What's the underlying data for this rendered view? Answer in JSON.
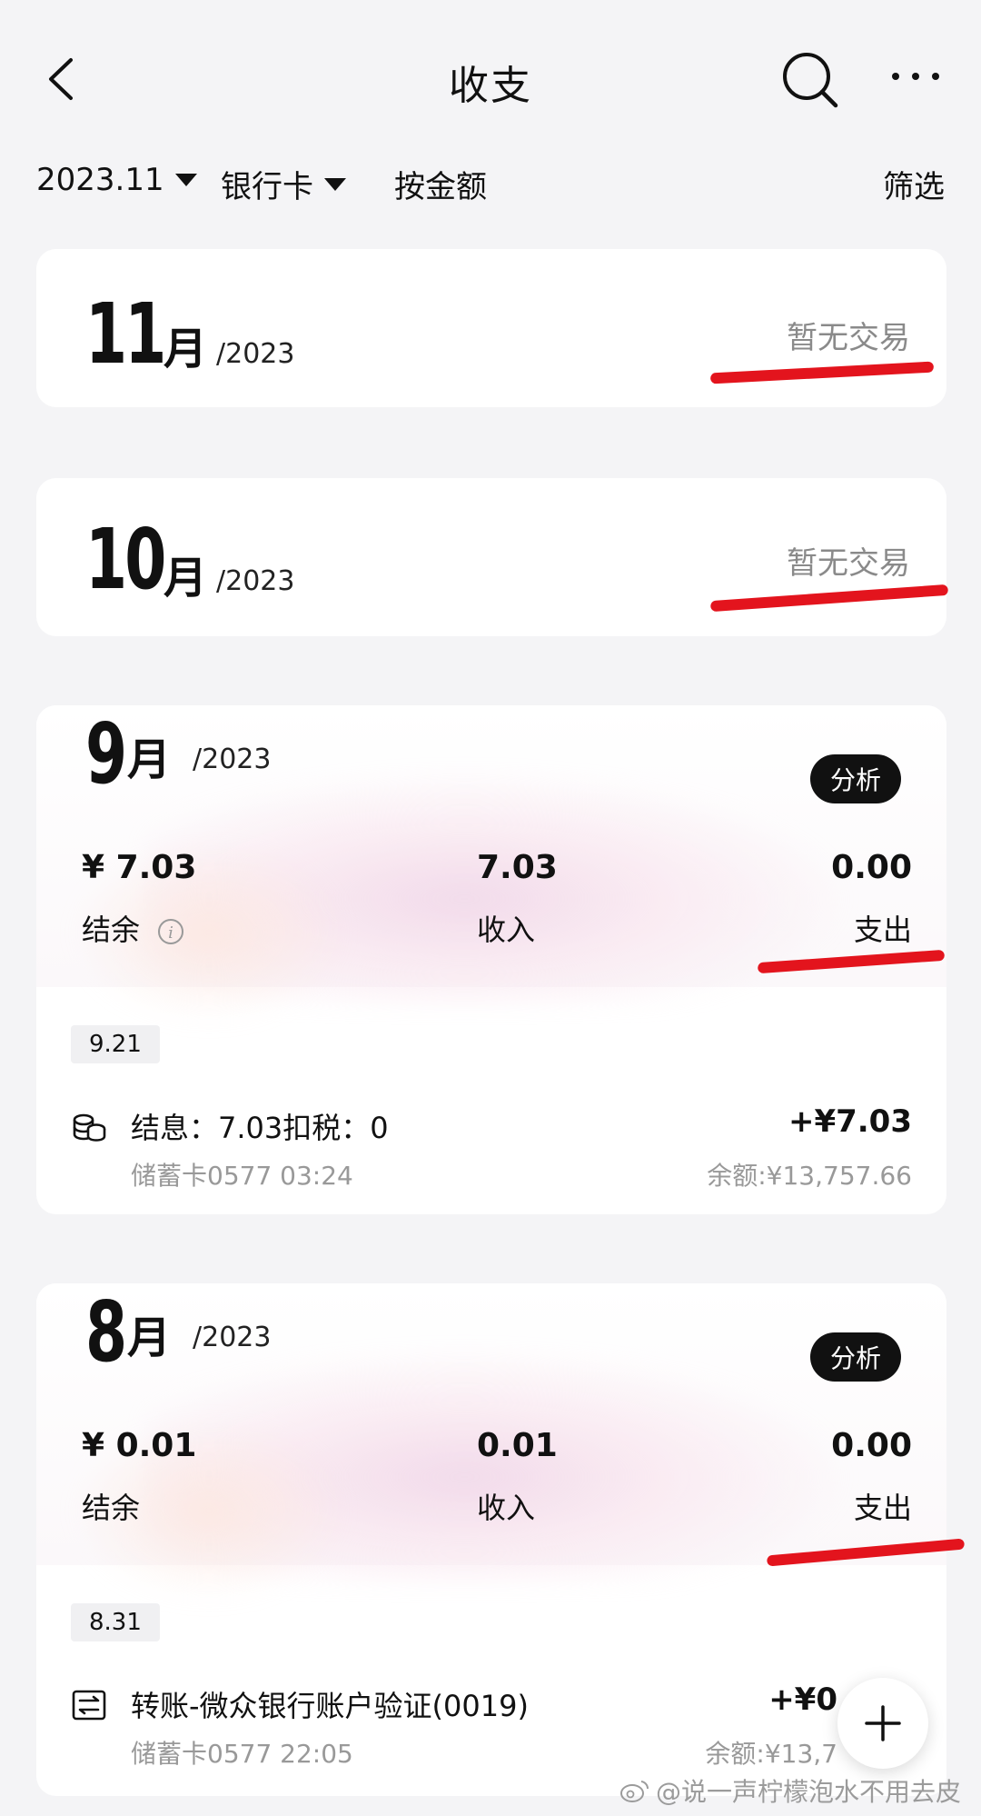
{
  "header": {
    "title": "收支"
  },
  "filters": {
    "month": "2023.11",
    "account": "银行卡",
    "sort": "按金额",
    "filter": "筛选"
  },
  "months": [
    {
      "month": "11",
      "suffix": "月",
      "year": "/2023",
      "status": "暂无交易"
    },
    {
      "month": "10",
      "suffix": "月",
      "year": "/2023",
      "status": "暂无交易"
    },
    {
      "month": "9",
      "suffix": "月",
      "year": "/2023",
      "analyze": "分析",
      "balance": "¥ 7.03",
      "balance_label": "结余",
      "income": "7.03",
      "income_label": "收入",
      "expense": "0.00",
      "expense_label": "支出",
      "date": "9.21",
      "tx": {
        "title": "结息：7.03扣税：0",
        "sub": "储蓄卡0577 03:24",
        "amount": "+¥7.03",
        "balance": "余额:¥13,757.66",
        "icon": "coins-icon"
      }
    },
    {
      "month": "8",
      "suffix": "月",
      "year": "/2023",
      "analyze": "分析",
      "balance": "¥ 0.01",
      "balance_label": "结余",
      "income": "0.01",
      "income_label": "收入",
      "expense": "0.00",
      "expense_label": "支出",
      "date": "8.31",
      "tx": {
        "title": "转账-微众银行账户验证(0019)",
        "sub": "储蓄卡0577 22:05",
        "amount": "+¥0",
        "balance": "余额:¥13,7",
        "icon": "transfer-icon"
      }
    }
  ],
  "watermark": "@说一声柠檬泡水不用去皮",
  "colors": {
    "annotation_red": "#e3141d",
    "text": "#111111",
    "muted": "#8a8a8a"
  }
}
